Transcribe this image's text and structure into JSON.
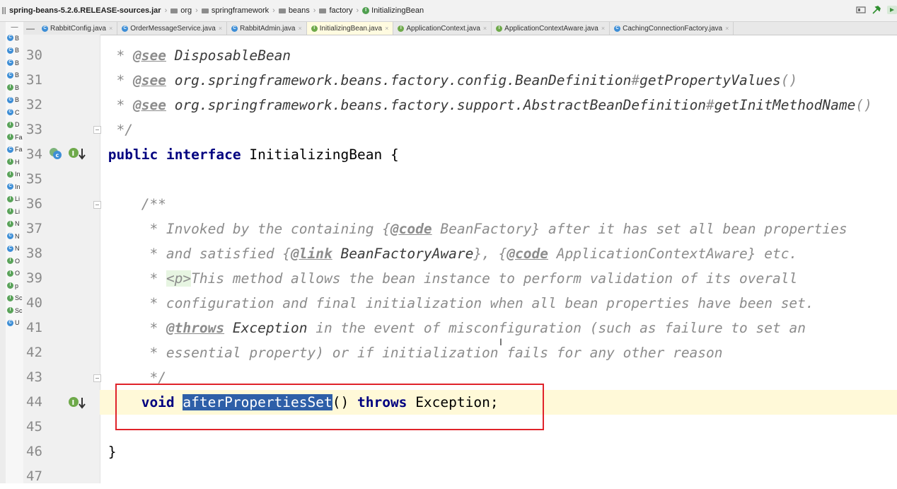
{
  "breadcrumb": {
    "jar": "spring-beans-5.2.6.RELEASE-sources.jar",
    "items": [
      "org",
      "springframework",
      "beans",
      "factory"
    ],
    "current": "InitializingBean"
  },
  "tabs": [
    {
      "label": "RabbitConfig.java",
      "icon": "C"
    },
    {
      "label": "OrderMessageService.java",
      "icon": "C"
    },
    {
      "label": "RabbitAdmin.java",
      "icon": "C"
    },
    {
      "label": "InitializingBean.java",
      "icon": "I",
      "active": true
    },
    {
      "label": "ApplicationContext.java",
      "icon": "I"
    },
    {
      "label": "ApplicationContextAware.java",
      "icon": "I"
    },
    {
      "label": "CachingConnectionFactory.java",
      "icon": "C"
    }
  ],
  "tree_items": [
    "B",
    "B",
    "B",
    "B",
    "B",
    "B",
    "C",
    "D",
    "Fa",
    "Fa",
    "H",
    "In",
    "In",
    "Li",
    "Li",
    "N",
    "N",
    "N",
    "O",
    "O",
    "p",
    "Sc",
    "Sc",
    "U"
  ],
  "tree_icons": [
    "C",
    "C",
    "C",
    "C",
    "I",
    "C",
    "C",
    "I",
    "I",
    "C",
    "I",
    "I",
    "C",
    "I",
    "I",
    "I",
    "C",
    "C",
    "I",
    "I",
    "I",
    "I",
    "I",
    "C"
  ],
  "line_numbers": [
    "30",
    "31",
    "32",
    "33",
    "34",
    "35",
    "36",
    "37",
    "38",
    "39",
    "40",
    "41",
    "42",
    "43",
    "44",
    "45",
    "46",
    "47"
  ],
  "code": {
    "l30_tag": "@see",
    "l30_ref": "DisposableBean",
    "l31_tag": "@see",
    "l31_ref": "org.springframework.beans.factory.config.BeanDefinition",
    "l31_hash": "#",
    "l31_ref2": "getPropertyValues",
    "l31_paren": "()",
    "l32_tag": "@see",
    "l32_ref": "org.springframework.beans.factory.support.AbstractBeanDefinition",
    "l32_hash": "#",
    "l32_ref2": "getInitMethodName",
    "l32_paren": "()",
    "l33": "*/",
    "l34_kw1": "public",
    "l34_kw2": "interface",
    "l34_name": "InitializingBean {",
    "l36": "/**",
    "l37_a": "* Invoked by the containing {",
    "l37_tag": "@code",
    "l37_ref": "BeanFactory",
    "l37_b": "} after it has set all bean properties",
    "l38_a": "* and satisfied {",
    "l38_tag": "@link",
    "l38_ref": "BeanFactoryAware",
    "l38_b": "}, {",
    "l38_tag2": "@code",
    "l38_ref2": "ApplicationContextAware",
    "l38_c": "} etc.",
    "l39_a": "* ",
    "l39_p": "<p>",
    "l39_b": "This method allows the bean instance to perform validation of its overall",
    "l40": "* configuration and final initialization when all bean properties have been set.",
    "l41_a": "* ",
    "l41_tag": "@throws",
    "l41_ref": "Exception",
    "l41_b": "in the event of misconfiguration (such as failure to set an",
    "l42": "* essential property) or if initialization fails for any other reason",
    "l43": "*/",
    "l44_kw": "void",
    "l44_method": "afterPropertiesSet",
    "l44_paren": "()",
    "l44_kw2": "throws",
    "l44_rest": "Exception;",
    "l46": "}"
  },
  "colors": {
    "keyword": "#000080",
    "comment": "#8c8c8c",
    "selection": "#2e5fa8",
    "highlight_box": "#e0232a",
    "current_line": "#fff9d8"
  }
}
